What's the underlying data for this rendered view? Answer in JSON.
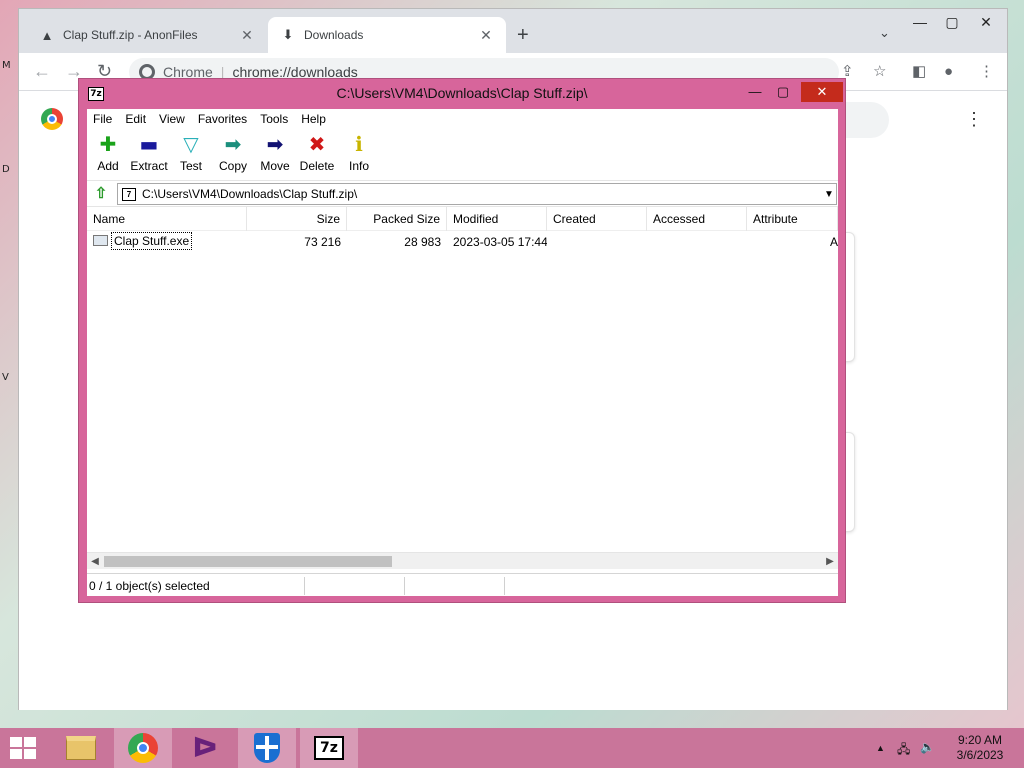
{
  "desktop": {
    "edge_fragments": [
      "M",
      "D",
      "V"
    ]
  },
  "browser": {
    "tabs": [
      {
        "title": "Clap Stuff.zip - AnonFiles",
        "icon": "anonfiles-icon",
        "active": false
      },
      {
        "title": "Downloads",
        "icon": "download-icon",
        "active": true
      }
    ],
    "new_tab": "+",
    "omnibox": {
      "scheme_label": "Chrome",
      "url": "chrome://downloads"
    }
  },
  "sevenzip": {
    "title": "C:\\Users\\VM4\\Downloads\\Clap Stuff.zip\\",
    "app_icon_text": "7z",
    "menu": [
      "File",
      "Edit",
      "View",
      "Favorites",
      "Tools",
      "Help"
    ],
    "toolbar": [
      {
        "label": "Add",
        "icon": "add-icon",
        "color": "#1aa31a",
        "glyph": "✚"
      },
      {
        "label": "Extract",
        "icon": "extract-icon",
        "color": "#1a1a9c",
        "glyph": "▬"
      },
      {
        "label": "Test",
        "icon": "test-icon",
        "color": "#2ab0b8",
        "glyph": "▽"
      },
      {
        "label": "Copy",
        "icon": "copy-icon",
        "color": "#1b8f7d",
        "glyph": "➡"
      },
      {
        "label": "Move",
        "icon": "move-icon",
        "color": "#121273",
        "glyph": "➡"
      },
      {
        "label": "Delete",
        "icon": "delete-icon",
        "color": "#d01818",
        "glyph": "✖"
      },
      {
        "label": "Info",
        "icon": "info-icon",
        "color": "#c8b400",
        "glyph": "ℹ"
      }
    ],
    "path": "C:\\Users\\VM4\\Downloads\\Clap Stuff.zip\\",
    "columns": [
      "Name",
      "Size",
      "Packed Size",
      "Modified",
      "Created",
      "Accessed",
      "Attribute"
    ],
    "rows": [
      {
        "name": "Clap Stuff.exe",
        "size": "73 216",
        "packed": "28 983",
        "modified": "2023-03-05 17:44",
        "created": "",
        "accessed": "",
        "attributes": "A"
      }
    ],
    "status": "0 / 1 object(s) selected"
  },
  "taskbar": {
    "apps": [
      {
        "name": "File Explorer",
        "icon": "file-explorer-icon"
      },
      {
        "name": "Google Chrome",
        "icon": "chrome-icon"
      },
      {
        "name": "Visual Studio",
        "icon": "visual-studio-icon"
      },
      {
        "name": "Windows Defender",
        "icon": "defender-shield-icon"
      },
      {
        "name": "7-Zip",
        "icon": "sevenzip-icon",
        "text": "7z"
      }
    ],
    "time": "9:20 AM",
    "date": "3/6/2023"
  },
  "colors": {
    "sevenzip_frame": "#d7659b",
    "taskbar": "#c9759a",
    "close_red": "#c42b1c"
  }
}
